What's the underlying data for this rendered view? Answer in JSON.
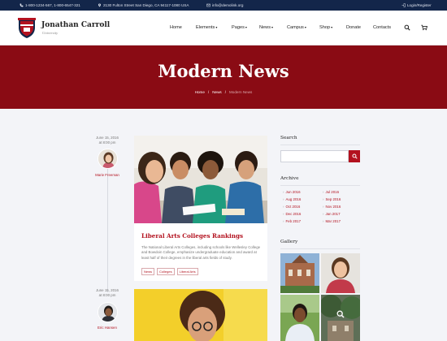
{
  "topbar": {
    "phone": "1-800-1234-567, 1-800-6547-321",
    "address": "2130 Fulton Street San Diego, CA 94117-1080 USA",
    "email": "info@demolink.org",
    "login": "Login/Register"
  },
  "header": {
    "title": "Jonathan Carroll",
    "subtitle": "University",
    "nav": [
      "Home",
      "Elements",
      "Pages",
      "News",
      "Campus",
      "Shop",
      "Donate",
      "Contacts"
    ],
    "nav_dropdowns": [
      "Elements",
      "Pages",
      "News",
      "Campus",
      "Shop"
    ]
  },
  "hero": {
    "title": "Modern News",
    "breadcrumb": [
      "Home",
      "News",
      "Modern News"
    ]
  },
  "posts": [
    {
      "date": "June 15, 2016",
      "time": "at 8:00 pm",
      "author": "Marie Freeman",
      "title": "Liberal Arts Colleges Rankings",
      "excerpt": "The National Liberal Arts Colleges, including schools like Wellesley College and Bowdoin College, emphasize undergraduate education and award at least half of their degrees in the liberal arts fields of study.",
      "tags": [
        "News",
        "Colleges",
        "Liberal Arts"
      ]
    },
    {
      "date": "June 15, 2016",
      "time": "at 8:00 pm",
      "author": "Eric Hansen"
    }
  ],
  "sidebar": {
    "search_title": "Search",
    "search_placeholder": "",
    "archive_title": "Archive",
    "archive_left": [
      "Jun 2016",
      "Aug 2016",
      "Oct 2016",
      "Dec 2016",
      "Feb 2017"
    ],
    "archive_right": [
      "Jul 2016",
      "Sep 2016",
      "Nov 2016",
      "Jan 2017",
      "Mar 2017"
    ],
    "gallery_title": "Gallery"
  },
  "colors": {
    "topbar": "#13264a",
    "brand_red": "#8a0b14",
    "accent_red": "#b3121f",
    "page_bg": "#f3f4f8"
  }
}
